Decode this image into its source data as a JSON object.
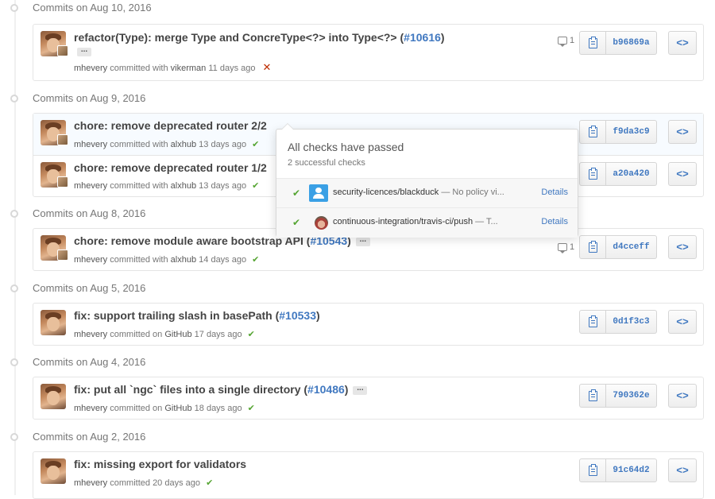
{
  "groups": [
    {
      "date": "Commits on Aug 10, 2016",
      "commits": [
        {
          "title": "refactor(Type): merge Type and ConcreType<?> into Type<?> (",
          "pr": "#10616",
          "title_end": ")",
          "author": "mhevery",
          "action": "committed with",
          "coauthor": "vikerman",
          "time": "11 days ago",
          "status": "fail",
          "status_icon": "✕",
          "comments": "1",
          "sha": "b96869a",
          "browse": "<>"
        }
      ]
    },
    {
      "date": "Commits on Aug 9, 2016",
      "commits": [
        {
          "title": "chore: remove deprecated router 2/2",
          "author": "mhevery",
          "action": "committed with",
          "coauthor": "alxhub",
          "time": "13 days ago",
          "status": "ok",
          "status_icon": "✔",
          "sha": "f9da3c9",
          "browse": "<>"
        },
        {
          "title": "chore: remove deprecated router 1/2",
          "author": "mhevery",
          "action": "committed with",
          "coauthor": "alxhub",
          "time": "13 days ago",
          "status": "ok",
          "status_icon": "✔",
          "sha": "a20a420",
          "browse": "<>"
        }
      ]
    },
    {
      "date": "Commits on Aug 8, 2016",
      "commits": [
        {
          "title": "chore: remove module aware bootstrap API (",
          "pr": "#10543",
          "title_end": ")",
          "author": "mhevery",
          "action": "committed with",
          "coauthor": "alxhub",
          "time": "14 days ago",
          "status": "ok",
          "status_icon": "✔",
          "comments": "1",
          "sha": "d4cceff",
          "browse": "<>"
        }
      ]
    },
    {
      "date": "Commits on Aug 5, 2016",
      "commits": [
        {
          "title": "fix: support trailing slash in basePath (",
          "pr": "#10533",
          "title_end": ")",
          "author": "mhevery",
          "action": "committed on",
          "coauthor": "GitHub",
          "time": "17 days ago",
          "status": "ok",
          "status_icon": "✔",
          "sha": "0d1f3c3",
          "browse": "<>"
        }
      ]
    },
    {
      "date": "Commits on Aug 4, 2016",
      "commits": [
        {
          "title": "fix: put all `ngc` files into a single directory (",
          "pr": "#10486",
          "title_end": ")",
          "author": "mhevery",
          "action": "committed on",
          "coauthor": "GitHub",
          "time": "18 days ago",
          "status": "ok",
          "status_icon": "✔",
          "sha": "790362e",
          "browse": "<>"
        }
      ]
    },
    {
      "date": "Commits on Aug 2, 2016",
      "commits": [
        {
          "title": "fix: missing export for validators",
          "author": "mhevery",
          "action": "committed",
          "time": "20 days ago",
          "status": "ok",
          "status_icon": "✔",
          "sha": "91c64d2",
          "browse": "<>"
        }
      ]
    }
  ],
  "ellipsis": "...",
  "popover": {
    "title": "All checks have passed",
    "subtitle": "2 successful checks",
    "checks": [
      {
        "check": "✔",
        "name": "security-licences/blackduck",
        "desc": " — No policy vi...",
        "details": "Details"
      },
      {
        "check": "✔",
        "name": "continuous-integration/travis-ci/push",
        "desc": " — T...",
        "details": "Details"
      }
    ]
  },
  "colors": {
    "link": "#4078c0",
    "success": "#55a532",
    "failure": "#bd2c00"
  }
}
